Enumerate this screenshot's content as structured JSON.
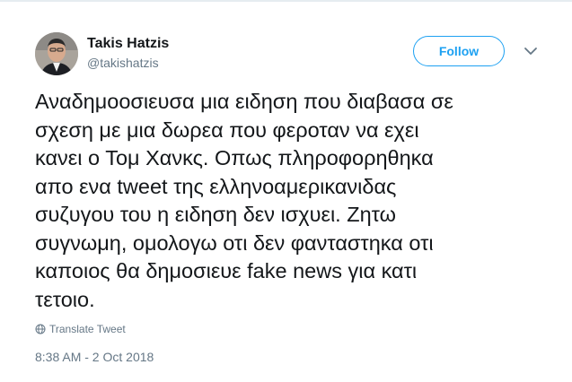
{
  "user": {
    "display_name": "Takis Hatzis",
    "handle": "@takishatzis"
  },
  "actions": {
    "follow_label": "Follow",
    "more_icon": "chevron-down-icon"
  },
  "tweet": {
    "text": "Αναδημοοσιευσα μια ειδηση που διαβασα σε\nσχεση με μια δωρεα που φεροταν να εχει\nκανει ο Τομ Χανκς. Οπως πληροφορηθηκα\nαπο ενα tweet της ελληνοαμερικανιδας\nσυζυγου του η ειδηση δεν ισχυει. Ζητω\nσυγνωμη, ομολογω οτι δεν φανταστηκα οτι\nκαποιος θα δημοσιευε fake news για κατι\nτετοιο.",
    "translate_label": "Translate Tweet",
    "translate_icon": "globe-icon",
    "timestamp": "8:38 AM - 2 Oct 2018"
  },
  "colors": {
    "accent": "#1da1f2",
    "text": "#14171a",
    "secondary": "#657786"
  }
}
